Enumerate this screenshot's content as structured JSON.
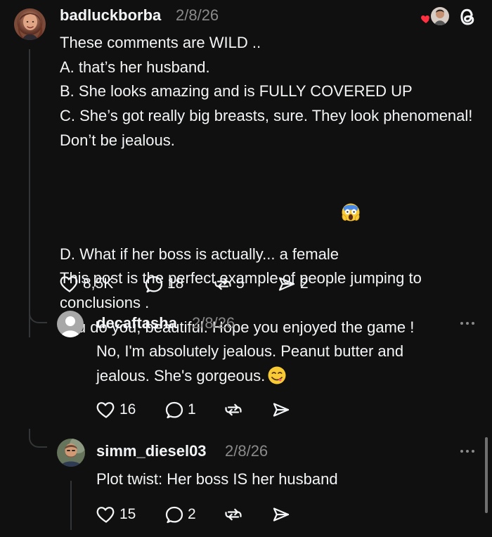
{
  "header": {
    "heart_icon": "heart-icon",
    "threads_icon": "threads-logo-icon",
    "accent_color": "#ff3040"
  },
  "main_comment": {
    "username": "badluckborba",
    "date": "2/8/26",
    "lines": [
      "These comments are WILD ..",
      "A. that’s her husband.",
      "B. She looks amazing and is FULLY COVERED UP",
      "C. She’s got really big breasts, sure. They look phenomenal! Don’t be jealous.",
      "D. What if her boss is actually... a female",
      "This post is the perfect example of people jumping to conclusions .",
      "You do you, beautiful. Hope you enjoyed the game !"
    ],
    "emoji_name": "face-screaming-in-fear-icon",
    "actions": {
      "likes": "8,5K",
      "replies": "18",
      "reposts": "5",
      "shares": "2"
    }
  },
  "replies": [
    {
      "username": "decaftasha",
      "date": "2/8/26",
      "lines": [
        "No, I'm absolutely jealous. Peanut butter and",
        "jealous. She's gorgeous."
      ],
      "emoji_name": "face-savoring-food-icon",
      "actions": {
        "likes": "16",
        "replies": "1"
      }
    },
    {
      "username": "simm_diesel03",
      "date": "2/8/26",
      "lines": [
        "Plot twist: Her boss IS her husband"
      ],
      "actions": {
        "likes": "15",
        "replies": "2"
      }
    }
  ]
}
